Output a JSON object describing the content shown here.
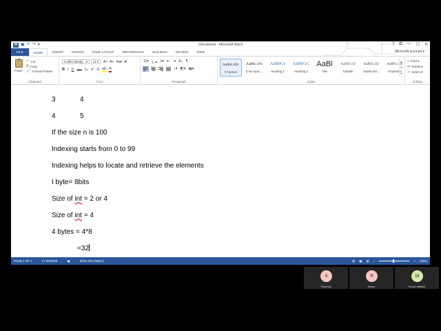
{
  "window": {
    "title": "Document1 - Microsoft Word",
    "buttons": {
      "help": "?",
      "ribbon_display": "⧉",
      "minimize": "—",
      "maximize": "☐",
      "close": "✕"
    }
  },
  "quick_access": {
    "logo": "W",
    "save": "▣",
    "undo": "↶",
    "redo": "↷",
    "customize": "▾"
  },
  "ribbon_tabs": [
    {
      "label": "FILE"
    },
    {
      "label": "HOME"
    },
    {
      "label": "INSERT"
    },
    {
      "label": "DESIGN"
    },
    {
      "label": "PAGE LAYOUT"
    },
    {
      "label": "REFERENCES"
    },
    {
      "label": "MAILINGS"
    },
    {
      "label": "REVIEW"
    },
    {
      "label": "VIEW"
    }
  ],
  "account": "Microsoft account ▾",
  "clipboard": {
    "paste": "Paste",
    "cut": "Cut",
    "copy": "Copy",
    "format_painter": "Format Painter",
    "label": "Clipboard"
  },
  "font": {
    "name": "Calibri (Body)",
    "size": "11",
    "label": "Font",
    "grow": "A˄",
    "shrink": "A˅",
    "case": "Aa▾",
    "clear": "A̸",
    "bold": "B",
    "italic": "I",
    "underline": "U",
    "strike": "abc",
    "sub": "x₂",
    "sup": "x²",
    "effects": "A",
    "highlight": "ab",
    "color": "A"
  },
  "paragraph": {
    "label": "Paragraph",
    "bullets": "☰▾",
    "numbering": "⒈▾",
    "multilevel": "≡▾",
    "decrease": "⇤",
    "increase": "⇥",
    "sort": "A↓",
    "marks": "¶",
    "spacing": "↕▾",
    "shading": "◩▾",
    "borders": "▦▾"
  },
  "styles": {
    "label": "Styles",
    "items": [
      {
        "sample": "AaBbCcDc",
        "name": "¶ Normal"
      },
      {
        "sample": "AaBbCcDc",
        "name": "¶ No Spac..."
      },
      {
        "sample": "AaBbCc",
        "name": "Heading 1"
      },
      {
        "sample": "AaBbCcC",
        "name": "Heading 2"
      },
      {
        "sample": "AaBl",
        "name": "Title"
      },
      {
        "sample": "AaBbCcD",
        "name": "Subtitle"
      },
      {
        "sample": "AaBbCcDc",
        "name": "Subtle Em..."
      },
      {
        "sample": "AaBbCcDc",
        "name": "Emphasis"
      }
    ]
  },
  "editing": {
    "label": "Editing",
    "find": "Find ▾",
    "replace": "Replace",
    "select": "Select ▾"
  },
  "document": {
    "lines": [
      {
        "a": "3",
        "b": "4"
      },
      {
        "a": "4",
        "b": "5"
      },
      {
        "text": "If the size n is 100"
      },
      {
        "text": "Indexing starts from 0 to 99"
      },
      {
        "text": "Indexing helps to locate and retrieve the elements"
      },
      {
        "text": "I byte= 8bits"
      },
      {
        "pre": "Size of ",
        "word": "int",
        "post": " = 2 or 4"
      },
      {
        "pre": "Size of ",
        "word": "int",
        "post": " = 4"
      },
      {
        "text": "4 bytes = 4*8"
      },
      {
        "text": "=32"
      }
    ]
  },
  "status_bar": {
    "page": "PAGE 1 OF 1",
    "words": "71 WORDS",
    "language": "ENGLISH (INDIA)",
    "zoom": "100%",
    "zoom_out": "−",
    "zoom_in": "+"
  },
  "participants": [
    {
      "initials": "S",
      "name": "Shreenas",
      "color": "#f4c7c3"
    },
    {
      "initials": "R",
      "name": "Rekha",
      "color": "#f4c7c3"
    },
    {
      "initials": "DI",
      "name": "Dream Institute",
      "color": "#d6e9a8"
    }
  ]
}
